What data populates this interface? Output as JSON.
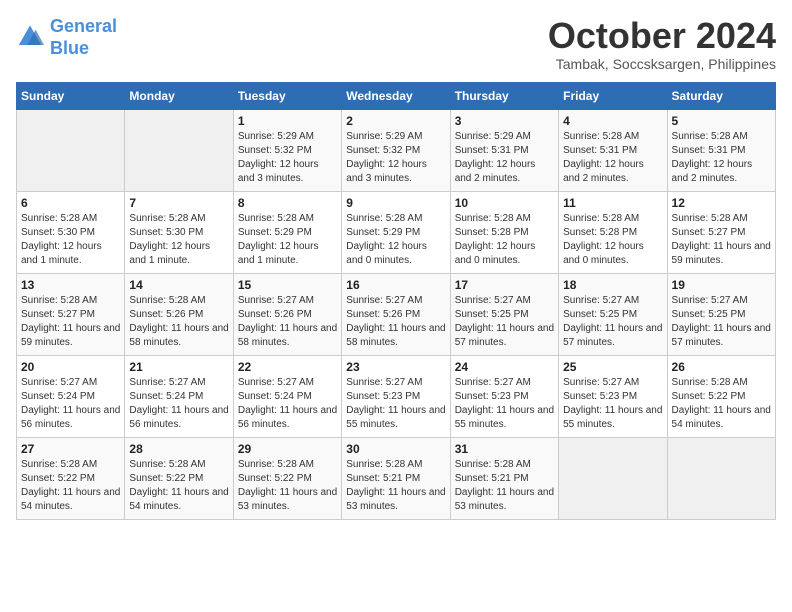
{
  "logo": {
    "line1": "General",
    "line2": "Blue"
  },
  "title": "October 2024",
  "subtitle": "Tambak, Soccsksargen, Philippines",
  "weekdays": [
    "Sunday",
    "Monday",
    "Tuesday",
    "Wednesday",
    "Thursday",
    "Friday",
    "Saturday"
  ],
  "weeks": [
    [
      {
        "day": "",
        "info": ""
      },
      {
        "day": "",
        "info": ""
      },
      {
        "day": "1",
        "info": "Sunrise: 5:29 AM\nSunset: 5:32 PM\nDaylight: 12 hours and 3 minutes."
      },
      {
        "day": "2",
        "info": "Sunrise: 5:29 AM\nSunset: 5:32 PM\nDaylight: 12 hours and 3 minutes."
      },
      {
        "day": "3",
        "info": "Sunrise: 5:29 AM\nSunset: 5:31 PM\nDaylight: 12 hours and 2 minutes."
      },
      {
        "day": "4",
        "info": "Sunrise: 5:28 AM\nSunset: 5:31 PM\nDaylight: 12 hours and 2 minutes."
      },
      {
        "day": "5",
        "info": "Sunrise: 5:28 AM\nSunset: 5:31 PM\nDaylight: 12 hours and 2 minutes."
      }
    ],
    [
      {
        "day": "6",
        "info": "Sunrise: 5:28 AM\nSunset: 5:30 PM\nDaylight: 12 hours and 1 minute."
      },
      {
        "day": "7",
        "info": "Sunrise: 5:28 AM\nSunset: 5:30 PM\nDaylight: 12 hours and 1 minute."
      },
      {
        "day": "8",
        "info": "Sunrise: 5:28 AM\nSunset: 5:29 PM\nDaylight: 12 hours and 1 minute."
      },
      {
        "day": "9",
        "info": "Sunrise: 5:28 AM\nSunset: 5:29 PM\nDaylight: 12 hours and 0 minutes."
      },
      {
        "day": "10",
        "info": "Sunrise: 5:28 AM\nSunset: 5:28 PM\nDaylight: 12 hours and 0 minutes."
      },
      {
        "day": "11",
        "info": "Sunrise: 5:28 AM\nSunset: 5:28 PM\nDaylight: 12 hours and 0 minutes."
      },
      {
        "day": "12",
        "info": "Sunrise: 5:28 AM\nSunset: 5:27 PM\nDaylight: 11 hours and 59 minutes."
      }
    ],
    [
      {
        "day": "13",
        "info": "Sunrise: 5:28 AM\nSunset: 5:27 PM\nDaylight: 11 hours and 59 minutes."
      },
      {
        "day": "14",
        "info": "Sunrise: 5:28 AM\nSunset: 5:26 PM\nDaylight: 11 hours and 58 minutes."
      },
      {
        "day": "15",
        "info": "Sunrise: 5:27 AM\nSunset: 5:26 PM\nDaylight: 11 hours and 58 minutes."
      },
      {
        "day": "16",
        "info": "Sunrise: 5:27 AM\nSunset: 5:26 PM\nDaylight: 11 hours and 58 minutes."
      },
      {
        "day": "17",
        "info": "Sunrise: 5:27 AM\nSunset: 5:25 PM\nDaylight: 11 hours and 57 minutes."
      },
      {
        "day": "18",
        "info": "Sunrise: 5:27 AM\nSunset: 5:25 PM\nDaylight: 11 hours and 57 minutes."
      },
      {
        "day": "19",
        "info": "Sunrise: 5:27 AM\nSunset: 5:25 PM\nDaylight: 11 hours and 57 minutes."
      }
    ],
    [
      {
        "day": "20",
        "info": "Sunrise: 5:27 AM\nSunset: 5:24 PM\nDaylight: 11 hours and 56 minutes."
      },
      {
        "day": "21",
        "info": "Sunrise: 5:27 AM\nSunset: 5:24 PM\nDaylight: 11 hours and 56 minutes."
      },
      {
        "day": "22",
        "info": "Sunrise: 5:27 AM\nSunset: 5:24 PM\nDaylight: 11 hours and 56 minutes."
      },
      {
        "day": "23",
        "info": "Sunrise: 5:27 AM\nSunset: 5:23 PM\nDaylight: 11 hours and 55 minutes."
      },
      {
        "day": "24",
        "info": "Sunrise: 5:27 AM\nSunset: 5:23 PM\nDaylight: 11 hours and 55 minutes."
      },
      {
        "day": "25",
        "info": "Sunrise: 5:27 AM\nSunset: 5:23 PM\nDaylight: 11 hours and 55 minutes."
      },
      {
        "day": "26",
        "info": "Sunrise: 5:28 AM\nSunset: 5:22 PM\nDaylight: 11 hours and 54 minutes."
      }
    ],
    [
      {
        "day": "27",
        "info": "Sunrise: 5:28 AM\nSunset: 5:22 PM\nDaylight: 11 hours and 54 minutes."
      },
      {
        "day": "28",
        "info": "Sunrise: 5:28 AM\nSunset: 5:22 PM\nDaylight: 11 hours and 54 minutes."
      },
      {
        "day": "29",
        "info": "Sunrise: 5:28 AM\nSunset: 5:22 PM\nDaylight: 11 hours and 53 minutes."
      },
      {
        "day": "30",
        "info": "Sunrise: 5:28 AM\nSunset: 5:21 PM\nDaylight: 11 hours and 53 minutes."
      },
      {
        "day": "31",
        "info": "Sunrise: 5:28 AM\nSunset: 5:21 PM\nDaylight: 11 hours and 53 minutes."
      },
      {
        "day": "",
        "info": ""
      },
      {
        "day": "",
        "info": ""
      }
    ]
  ]
}
